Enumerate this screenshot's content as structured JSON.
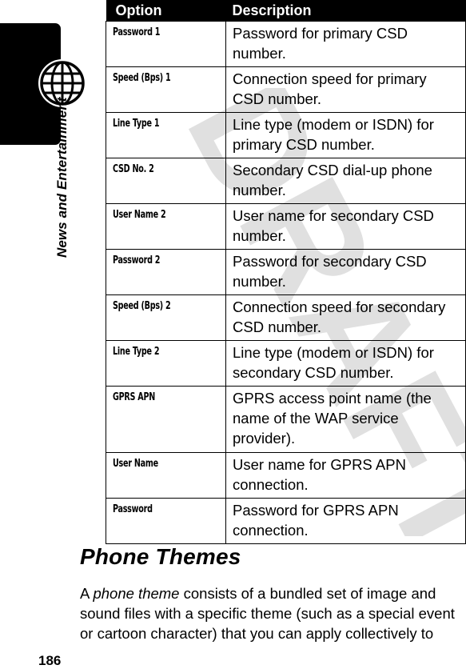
{
  "sidebar": {
    "section_label": "News and Entertainment",
    "icon": "globe-icon"
  },
  "watermark": {
    "text": "DRAFT",
    "color": "#d0d0d0"
  },
  "table": {
    "headers": {
      "option": "Option",
      "description": "Description"
    },
    "rows": [
      {
        "option": "Password 1",
        "description": "Password for primary CSD number."
      },
      {
        "option": "Speed (Bps) 1",
        "description": "Connection speed for primary CSD number."
      },
      {
        "option": "Line Type 1",
        "description": "Line type (modem or ISDN) for primary CSD number."
      },
      {
        "option": "CSD No. 2",
        "description": "Secondary CSD dial-up phone number."
      },
      {
        "option": "User Name 2",
        "description": "User name for secondary CSD number."
      },
      {
        "option": "Password 2",
        "description": "Password for secondary CSD number."
      },
      {
        "option": "Speed (Bps) 2",
        "description": "Connection speed for secondary CSD number."
      },
      {
        "option": "Line Type 2",
        "description": "Line type (modem or ISDN) for secondary CSD number."
      },
      {
        "option": "GPRS APN",
        "description": "GPRS access point name (the name of the WAP service provider)."
      },
      {
        "option": "User Name",
        "description": "User name for GPRS APN connection."
      },
      {
        "option": "Password",
        "description": "Password for GPRS APN connection."
      }
    ]
  },
  "section": {
    "title": "Phone Themes",
    "body_prefix": "A ",
    "body_term": "phone theme",
    "body_rest": " consists of a bundled set of image and sound files with a specific theme (such as a special event or cartoon character) that you can apply collectively to"
  },
  "page_number": "186"
}
